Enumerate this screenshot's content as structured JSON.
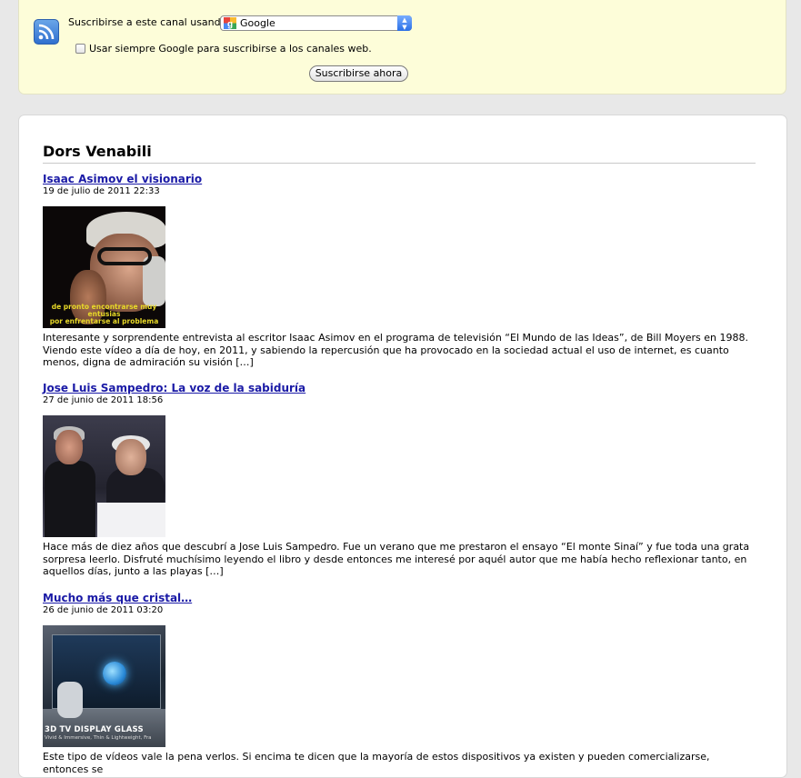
{
  "subscription": {
    "label": "Suscribirse a este canal usando",
    "selected_reader": "Google",
    "always_use_label": "Usar siempre Google para suscribirse a los canales web.",
    "subscribe_button": "Suscribirse ahora"
  },
  "feed": {
    "title": "Dors Venabili",
    "entries": [
      {
        "title": "Isaac Asimov el visionario",
        "date": "19 de julio de 2011 22:33",
        "thumb_caption": "de pronto encontrarse muy entusias\npor enfrentarse al problema",
        "summary": "Interesante y sorprendente entrevista al escritor Isaac Asimov en el programa de televisión “El Mundo de las Ideas”, de Bill Moyers en 1988. Viendo este vídeo a día de hoy, en 2011, y sabiendo la repercusión que ha provocado en la sociedad actual el uso de internet, es cuanto menos, digna de admiración su visión […]"
      },
      {
        "title": "Jose Luis Sampedro: La voz de la sabiduría",
        "date": "27 de junio de 2011 18:56",
        "summary": "Hace más de diez años que descubrí a Jose Luis Sampedro. Fue un verano que me prestaron el ensayo “El monte Sinaí” y fue toda una grata sorpresa leerlo. Disfruté muchísimo leyendo el libro y desde entonces me interesé por aquél autor que me había hecho reflexionar tanto, en aquellos días, junto a las playas […]"
      },
      {
        "title": "Mucho más que cristal…",
        "date": "26 de junio de 2011 03:20",
        "thumb_caption": "3D TV DISPLAY GLASS",
        "thumb_caption_small": "Vivid & Immersive, Thin & Lightweight, Fra",
        "summary": "Este tipo de vídeos vale la pena verlos. Si encima te dicen que la mayoría de estos dispositivos ya existen y pueden comercializarse, entonces se"
      }
    ]
  },
  "colors": {
    "link": "#1a1aa6",
    "subscribe_box_bg": "#fdfdd9",
    "page_bg": "#e8e8e8"
  }
}
